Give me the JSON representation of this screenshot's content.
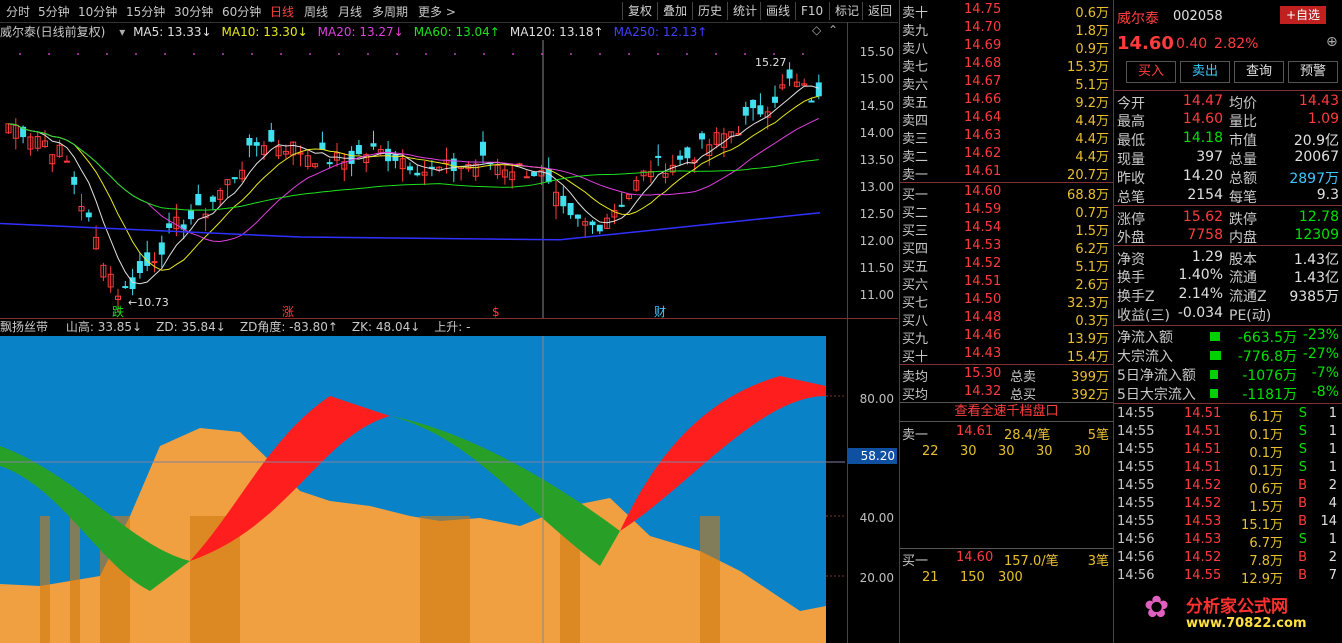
{
  "toolbar": {
    "periods": [
      "分时",
      "5分钟",
      "10分钟",
      "15分钟",
      "30分钟",
      "60分钟",
      "日线",
      "周线",
      "月线",
      "多周期",
      "更多 >"
    ],
    "active_period": "日线",
    "buttons": [
      "复权",
      "叠加",
      "历史",
      "统计",
      "画线",
      "F10",
      "标记",
      "返回"
    ]
  },
  "main_legend": {
    "title": "威尔泰(日线前复权)",
    "ma": [
      {
        "label": "MA5: 13.33↓",
        "color": "#e0e0e0"
      },
      {
        "label": "MA10: 13.30↓",
        "color": "#e8e820"
      },
      {
        "label": "MA20: 13.27↓",
        "color": "#e040e0"
      },
      {
        "label": "MA60: 13.04↑",
        "color": "#20e020"
      },
      {
        "label": "MA120: 13.18↑",
        "color": "#e0e0e0"
      },
      {
        "label": "MA250: 12.13↑",
        "color": "#4040ff"
      }
    ]
  },
  "price_axis": [
    "15.50",
    "15.00",
    "14.50",
    "14.00",
    "13.50",
    "13.00",
    "12.50",
    "12.00",
    "11.50",
    "11.00"
  ],
  "chart_annotations": {
    "high": "15.27",
    "low": "10.73",
    "markers": [
      "跌",
      "涨",
      "$",
      "财"
    ]
  },
  "sub_legend": {
    "title": "飘扬丝带",
    "items": [
      "山高: 33.85↓",
      "ZD: 35.84↓",
      "ZD角度: -83.80↑",
      "ZK: 48.04↓",
      "上升: -"
    ]
  },
  "sub_axis": [
    "80.00",
    "40.00",
    "20.00"
  ],
  "cursor_value": "58.20",
  "order_book": {
    "sell": [
      {
        "label": "卖十",
        "price": "14.75",
        "vol": "0.6万"
      },
      {
        "label": "卖九",
        "price": "14.70",
        "vol": "1.8万"
      },
      {
        "label": "卖八",
        "price": "14.69",
        "vol": "0.9万"
      },
      {
        "label": "卖七",
        "price": "14.68",
        "vol": "15.3万"
      },
      {
        "label": "卖六",
        "price": "14.67",
        "vol": "5.1万"
      },
      {
        "label": "卖五",
        "price": "14.66",
        "vol": "9.2万"
      },
      {
        "label": "卖四",
        "price": "14.64",
        "vol": "4.4万"
      },
      {
        "label": "卖三",
        "price": "14.63",
        "vol": "4.4万"
      },
      {
        "label": "卖二",
        "price": "14.62",
        "vol": "4.4万"
      },
      {
        "label": "卖一",
        "price": "14.61",
        "vol": "20.7万"
      }
    ],
    "buy": [
      {
        "label": "买一",
        "price": "14.60",
        "vol": "68.8万"
      },
      {
        "label": "买二",
        "price": "14.59",
        "vol": "0.7万"
      },
      {
        "label": "买三",
        "price": "14.54",
        "vol": "1.5万"
      },
      {
        "label": "买四",
        "price": "14.53",
        "vol": "6.2万"
      },
      {
        "label": "买五",
        "price": "14.52",
        "vol": "5.1万"
      },
      {
        "label": "买六",
        "price": "14.51",
        "vol": "2.6万"
      },
      {
        "label": "买七",
        "price": "14.50",
        "vol": "32.3万"
      },
      {
        "label": "买八",
        "price": "14.48",
        "vol": "0.3万"
      },
      {
        "label": "买九",
        "price": "14.46",
        "vol": "13.9万"
      },
      {
        "label": "买十",
        "price": "14.43",
        "vol": "15.4万"
      }
    ],
    "avg_sell_label": "卖均",
    "avg_sell": "15.30",
    "total_sell_label": "总卖",
    "total_sell": "399万",
    "avg_buy_label": "买均",
    "avg_buy": "14.32",
    "total_buy_label": "总买",
    "total_buy": "392万",
    "link": "查看全速千档盘口",
    "queue_sell": {
      "label": "卖一",
      "price": "14.61",
      "info": "28.4/笔",
      "count": "5笔",
      "orders": [
        "22",
        "30",
        "30",
        "30",
        "30"
      ]
    },
    "queue_buy": {
      "label": "买一",
      "price": "14.60",
      "info": "157.0/笔",
      "count": "3笔",
      "orders": [
        "21",
        "150",
        "300"
      ]
    }
  },
  "stock": {
    "name": "威尔泰",
    "code": "002058",
    "add_button": "+自选",
    "price": "14.60",
    "change": "0.40",
    "pct": "2.82%",
    "actions": [
      "买入",
      "卖出",
      "查询",
      "预警"
    ]
  },
  "quote": [
    [
      {
        "l": "今开",
        "v": "14.47",
        "c": "red"
      },
      {
        "l": "均价",
        "v": "14.43",
        "c": "red"
      }
    ],
    [
      {
        "l": "最高",
        "v": "14.60",
        "c": "red"
      },
      {
        "l": "量比",
        "v": "1.09",
        "c": "red"
      }
    ],
    [
      {
        "l": "最低",
        "v": "14.18",
        "c": "green"
      },
      {
        "l": "市值",
        "v": "20.9亿",
        "c": "white"
      }
    ],
    [
      {
        "l": "现量",
        "v": "397",
        "c": "white"
      },
      {
        "l": "总量",
        "v": "20067",
        "c": "white"
      }
    ],
    [
      {
        "l": "昨收",
        "v": "14.20",
        "c": "white"
      },
      {
        "l": "总额",
        "v": "2897万",
        "c": "cyan"
      }
    ],
    [
      {
        "l": "总笔",
        "v": "2154",
        "c": "white"
      },
      {
        "l": "每笔",
        "v": "9.3",
        "c": "white"
      }
    ],
    [
      {
        "l": "涨停",
        "v": "15.62",
        "c": "red"
      },
      {
        "l": "跌停",
        "v": "12.78",
        "c": "green"
      }
    ],
    [
      {
        "l": "外盘",
        "v": "7758",
        "c": "red"
      },
      {
        "l": "内盘",
        "v": "12309",
        "c": "green"
      }
    ],
    [
      {
        "l": "净资",
        "v": "1.29",
        "c": "white"
      },
      {
        "l": "股本",
        "v": "1.43亿",
        "c": "white"
      }
    ],
    [
      {
        "l": "换手",
        "v": "1.40%",
        "c": "white"
      },
      {
        "l": "流通",
        "v": "1.43亿",
        "c": "white"
      }
    ],
    [
      {
        "l": "换手Z",
        "v": "2.14%",
        "c": "white"
      },
      {
        "l": "流通Z",
        "v": "9385万",
        "c": "white"
      }
    ],
    [
      {
        "l": "收益(三)",
        "v": "-0.034",
        "c": "white"
      },
      {
        "l": "PE(动)",
        "v": "",
        "c": "white"
      }
    ]
  ],
  "flows": [
    {
      "l": "净流入额",
      "v": "-663.5万",
      "p": "-23%",
      "bar": 0.6
    },
    {
      "l": "大宗流入",
      "v": "-776.8万",
      "p": "-27%",
      "bar": 0.7
    },
    {
      "l": "5日净流入额",
      "v": "-1076万",
      "p": "-7%",
      "bar": 0.5
    },
    {
      "l": "5日大宗流入",
      "v": "-1181万",
      "p": "-8%",
      "bar": 0.5
    }
  ],
  "ticks": [
    {
      "t": "14:55",
      "p": "14.51",
      "v": "6.1万",
      "s": "S",
      "n": "1"
    },
    {
      "t": "14:55",
      "p": "14.51",
      "v": "0.1万",
      "s": "S",
      "n": "1"
    },
    {
      "t": "14:55",
      "p": "14.51",
      "v": "0.1万",
      "s": "S",
      "n": "1"
    },
    {
      "t": "14:55",
      "p": "14.51",
      "v": "0.1万",
      "s": "S",
      "n": "1"
    },
    {
      "t": "14:55",
      "p": "14.52",
      "v": "0.6万",
      "s": "B",
      "n": "2"
    },
    {
      "t": "14:55",
      "p": "14.52",
      "v": "1.5万",
      "s": "B",
      "n": "4"
    },
    {
      "t": "14:55",
      "p": "14.53",
      "v": "15.1万",
      "s": "B",
      "n": "14"
    },
    {
      "t": "14:56",
      "p": "14.53",
      "v": "6.7万",
      "s": "S",
      "n": "1"
    },
    {
      "t": "14:56",
      "p": "14.52",
      "v": "7.8万",
      "s": "B",
      "n": "2"
    },
    {
      "t": "14:56",
      "p": "14.55",
      "v": "12.9万",
      "s": "B",
      "n": "7"
    }
  ],
  "watermark": {
    "name": "分析家公式网",
    "url": "www.70822.com"
  }
}
